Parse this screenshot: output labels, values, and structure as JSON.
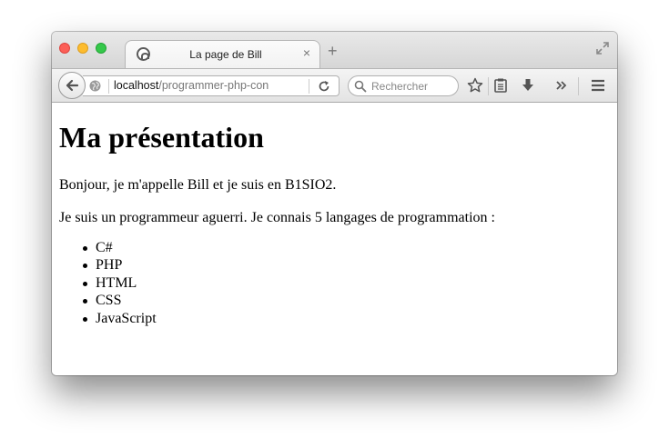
{
  "tab": {
    "title": "La page de Bill",
    "close_glyph": "×",
    "new_tab_glyph": "+"
  },
  "navbar": {
    "url_host": "localhost",
    "url_path": "/programmer-php-con",
    "search_placeholder": "Rechercher"
  },
  "icons": {
    "back": "back-arrow-icon",
    "site": "globe-icon",
    "reload": "reload-icon",
    "search": "search-icon",
    "bookmark": "star-icon",
    "reader": "clipboard-icon",
    "downloads": "download-icon",
    "overflow": "chevron-double-right-icon",
    "menu": "hamburger-menu-icon",
    "fullscreen": "fullscreen-icon"
  },
  "page": {
    "heading": "Ma présentation",
    "paragraph1": "Bonjour, je m'appelle Bill et je suis en B1SIO2.",
    "paragraph2": "Je suis un programmeur aguerri. Je connais 5 langages de programmation :",
    "languages": [
      "C#",
      "PHP",
      "HTML",
      "CSS",
      "JavaScript"
    ]
  },
  "colors": {
    "close": "#fc5f57",
    "minimize": "#fdbc2e",
    "maximize": "#35c84a"
  }
}
